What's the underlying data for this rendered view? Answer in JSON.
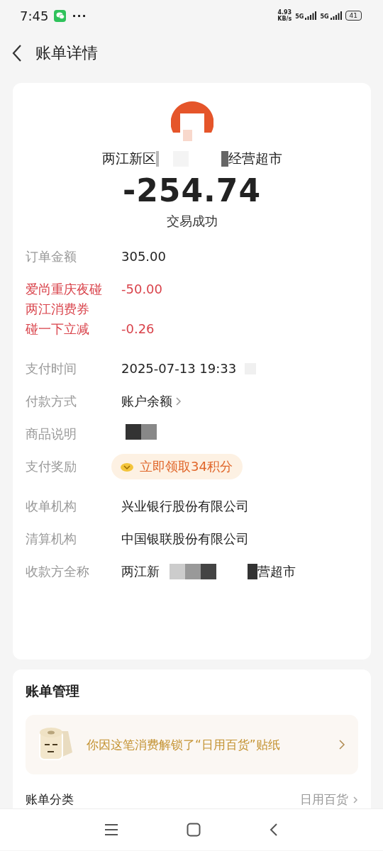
{
  "status_bar": {
    "time": "7:45",
    "more": "···",
    "speed": "4.93",
    "speed_unit": "KB/s",
    "networks": [
      "5G",
      "5G"
    ],
    "battery": "41"
  },
  "header": {
    "title": "账单详情"
  },
  "merchant": {
    "name_start": "两江新区",
    "name_end": "经营超市",
    "amount": "-254.74",
    "status": "交易成功"
  },
  "rows": [
    {
      "kind": "text",
      "label": "订单金额",
      "value": "305.00"
    },
    {
      "kind": "discount",
      "label": "爱尚重庆夜碰两江消费券",
      "value": "-50.00"
    },
    {
      "kind": "discount",
      "label": "碰一下立减",
      "value": "-0.26"
    },
    {
      "kind": "time",
      "label": "支付时间",
      "value": "2025-07-13 19:33"
    },
    {
      "kind": "link",
      "label": "付款方式",
      "value": "账户余额"
    },
    {
      "kind": "redacted",
      "label": "商品说明"
    },
    {
      "kind": "reward",
      "label": "支付奖励",
      "value": "立即领取34积分"
    },
    {
      "kind": "text",
      "label": "收单机构",
      "value": "兴业银行股份有限公司"
    },
    {
      "kind": "text",
      "label": "清算机构",
      "value": "中国银联股份有限公司"
    },
    {
      "kind": "payee",
      "label": "收款方全称",
      "value": "两江新",
      "value_end": "营超市"
    }
  ],
  "manage": {
    "title": "账单管理",
    "sticker_text": "你因这笔消费解锁了“日用百货”贴纸",
    "category_label": "账单分类",
    "category_value": "日用百货"
  }
}
